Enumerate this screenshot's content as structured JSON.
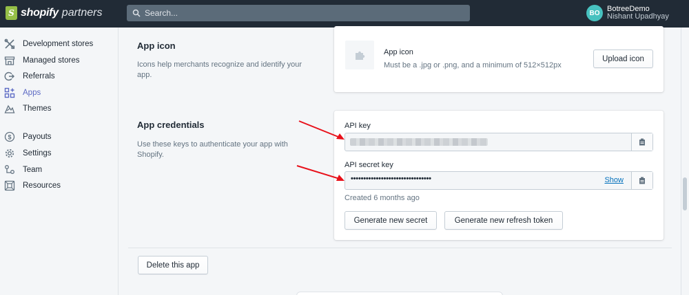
{
  "brand": {
    "name": "shopify",
    "suffix": "partners",
    "accent": "#95bf47"
  },
  "search": {
    "placeholder": "Search..."
  },
  "user": {
    "initials": "BO",
    "store": "BotreeDemo",
    "name": "Nishant Upadhyay",
    "avatar_color": "#47c1bf"
  },
  "sidebar": {
    "items": [
      {
        "label": "Development stores",
        "icon": "tools-icon",
        "active": false
      },
      {
        "label": "Managed stores",
        "icon": "store-icon",
        "active": false
      },
      {
        "label": "Referrals",
        "icon": "referral-icon",
        "active": false
      },
      {
        "label": "Apps",
        "icon": "apps-icon",
        "active": true
      },
      {
        "label": "Themes",
        "icon": "themes-icon",
        "active": false
      },
      {
        "label": "Payouts",
        "icon": "dollar-icon",
        "active": false
      },
      {
        "label": "Settings",
        "icon": "gear-icon",
        "active": false
      },
      {
        "label": "Team",
        "icon": "team-icon",
        "active": false
      },
      {
        "label": "Resources",
        "icon": "resources-icon",
        "active": false
      }
    ]
  },
  "app_icon": {
    "title": "App icon",
    "description": "Icons help merchants recognize and identify your app.",
    "card_title": "App icon",
    "card_hint": "Must be a .jpg or .png, and a minimum of 512×512px",
    "upload_label": "Upload icon"
  },
  "credentials": {
    "title": "App credentials",
    "description": "Use these keys to authenticate your app with Shopify.",
    "api_key_label": "API key",
    "api_secret_label": "API secret key",
    "secret_masked": "••••••••••••••••••••••••••••••••",
    "show_label": "Show",
    "created": "Created 6 months ago",
    "generate_secret_label": "Generate new secret",
    "generate_token_label": "Generate new refresh token"
  },
  "delete_label": "Delete this app",
  "colors": {
    "topbar": "#212b36",
    "link": "#006fbb",
    "active_nav": "#5c6ac4",
    "annotation_arrow": "#e8101a"
  }
}
